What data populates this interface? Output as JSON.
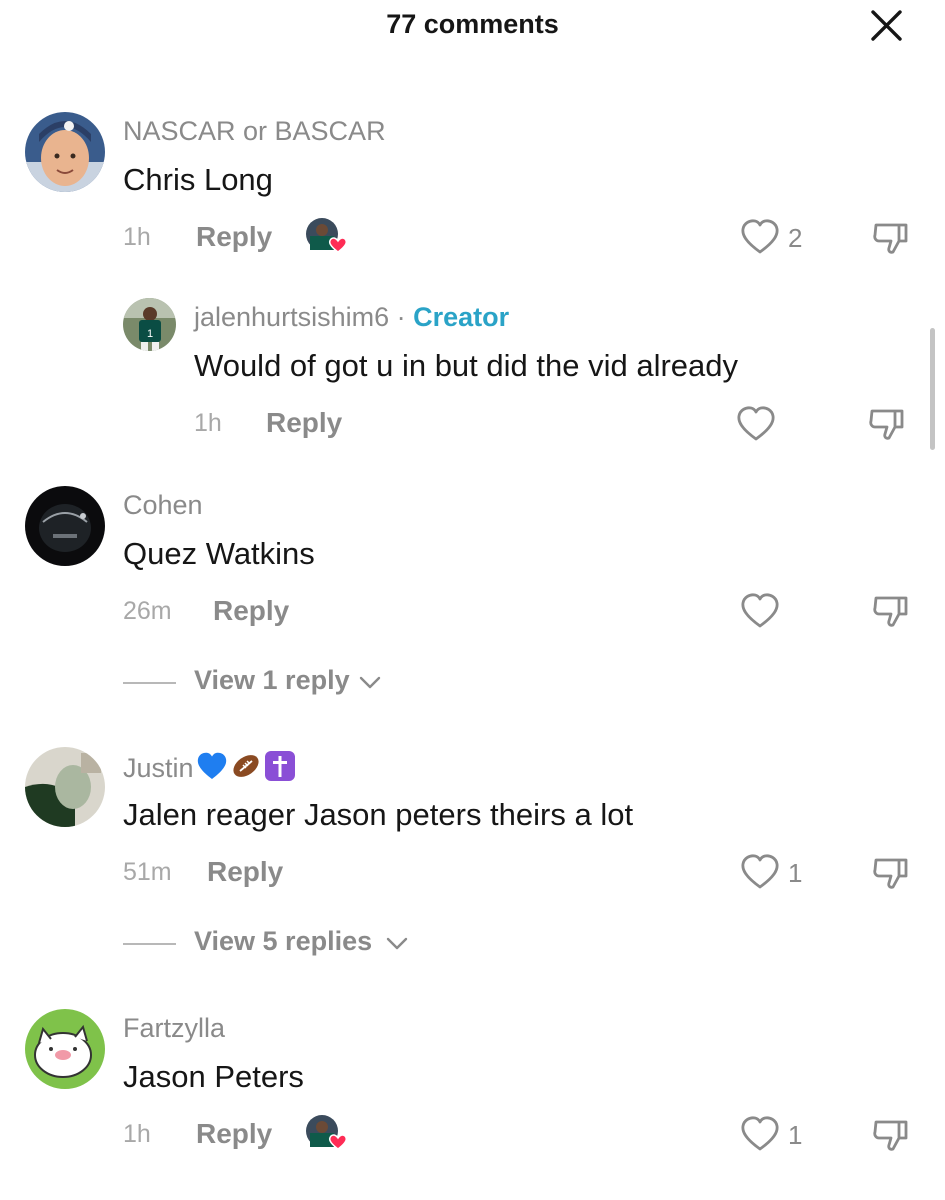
{
  "header": {
    "title": "77 comments",
    "close_icon": "close-icon"
  },
  "comments": [
    {
      "username": "NASCAR or BASCAR",
      "text": "Chris Long",
      "time": "1h",
      "reply_label": "Reply",
      "likes": "2",
      "liked_by_creator": true
    },
    {
      "username": "jalenhurtsishim6",
      "separator": "·",
      "badge": "Creator",
      "text": "Would of got u in but did the vid already",
      "time": "1h",
      "reply_label": "Reply",
      "likes": ""
    },
    {
      "username": "Cohen",
      "text": "Quez Watkins",
      "time": "26m",
      "reply_label": "Reply",
      "likes": "",
      "view_replies": "View 1 reply"
    },
    {
      "username": "Justin",
      "username_emojis": [
        "blue-heart",
        "football",
        "latin-cross"
      ],
      "text": "Jalen reager Jason peters theirs a lot",
      "time": "51m",
      "reply_label": "Reply",
      "likes": "1",
      "view_replies": "View 5 replies"
    },
    {
      "username": "Fartzylla",
      "text": "Jason Peters",
      "time": "1h",
      "reply_label": "Reply",
      "likes": "1",
      "liked_by_creator": true
    }
  ],
  "colors": {
    "creator_badge": "#2aa3c7",
    "creator_like_heart": "#fe2c55",
    "secondary_text": "#8a8a8a"
  }
}
